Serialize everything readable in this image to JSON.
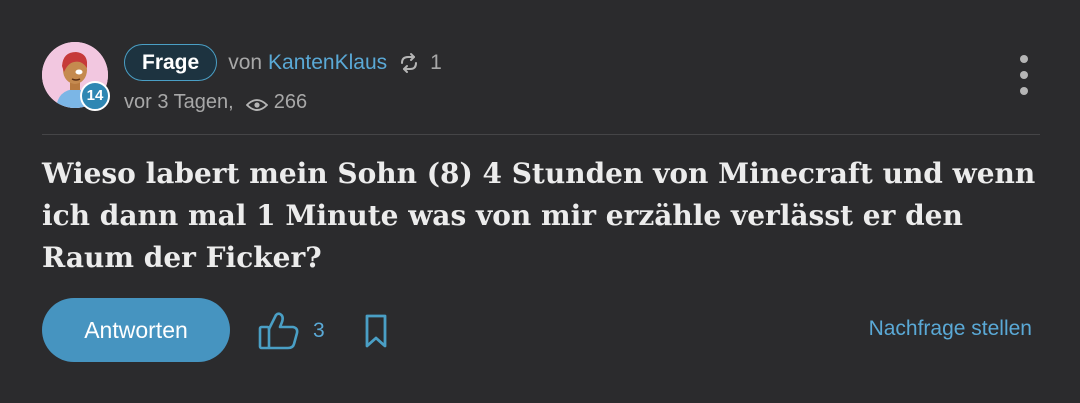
{
  "header": {
    "avatar_icon": "user-avatar",
    "level": "14",
    "type_label": "Frage",
    "by_label": "von",
    "author": "KantenKlaus",
    "sync_icon": "repost-icon",
    "sync_count": "1",
    "time_ago": "vor 3 Tagen,",
    "views_icon": "eye-icon",
    "views": "266",
    "menu_icon": "more-vertical-icon"
  },
  "question": {
    "text": "Wieso labert mein Sohn (8) 4 Stunden von Minecraft und wenn ich dann mal 1 Minute was von mir erzähle verlässt er den Raum der Ficker?"
  },
  "actions": {
    "answer_label": "Antworten",
    "like_icon": "thumbs-up-icon",
    "like_count": "3",
    "bookmark_icon": "bookmark-icon",
    "followup_label": "Nachfrage stellen"
  },
  "colors": {
    "background": "#2b2b2d",
    "accent": "#4694c0",
    "link": "#5aa9d6",
    "muted_text": "#a8a8a8"
  }
}
